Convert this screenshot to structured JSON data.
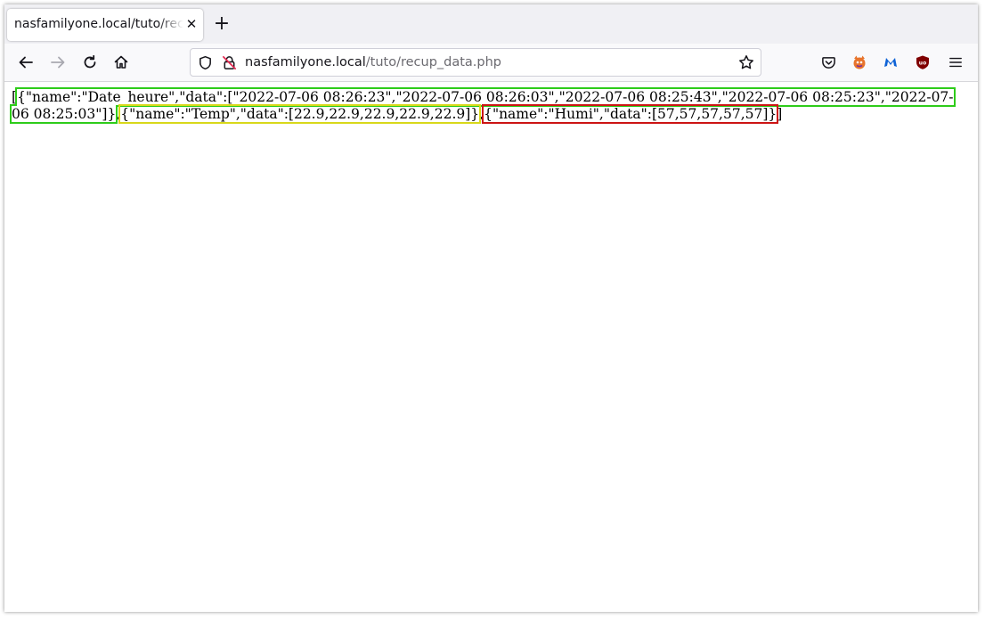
{
  "tab": {
    "title": "nasfamilyone.local/tuto/recup_data.php",
    "close_icon": "close-icon"
  },
  "newtab": {
    "label": "+"
  },
  "nav": {
    "back_icon": "back-arrow-icon",
    "forward_icon": "forward-arrow-icon",
    "reload_icon": "reload-icon",
    "home_icon": "home-icon"
  },
  "urlbar": {
    "host": "nasfamilyone.local",
    "path": "/tuto/recup_data.php",
    "left_icons": [
      "shield-icon",
      "insecure-lock-icon"
    ],
    "right_icon": "bookmark-star-icon"
  },
  "toolbar_icons": [
    "pocket-icon",
    "extension-fox-icon",
    "malwarebytes-icon",
    "ublock-origin-icon",
    "menu-icon"
  ],
  "page": {
    "prefix": "[",
    "seg_green": "{\"name\":\"Date_heure\",\"data\":[\"2022-07-06 08:26:23\",\"2022-07-06 08:26:03\",\"2022-07-06 08:25:43\",\"2022-07-06 08:25:23\",\"2022-07-06 08:25:03\"]}",
    "sep1": ",",
    "seg_yellow": "{\"name\":\"Temp\",\"data\":[22.9,22.9,22.9,22.9,22.9]}",
    "sep2": ",",
    "seg_red": "{\"name\":\"Humi\",\"data\":[57,57,57,57,57]}",
    "suffix": "]"
  },
  "highlight_colors": {
    "green": "#2ecc1a",
    "yellow": "#d8d81a",
    "red": "#cc1414"
  }
}
